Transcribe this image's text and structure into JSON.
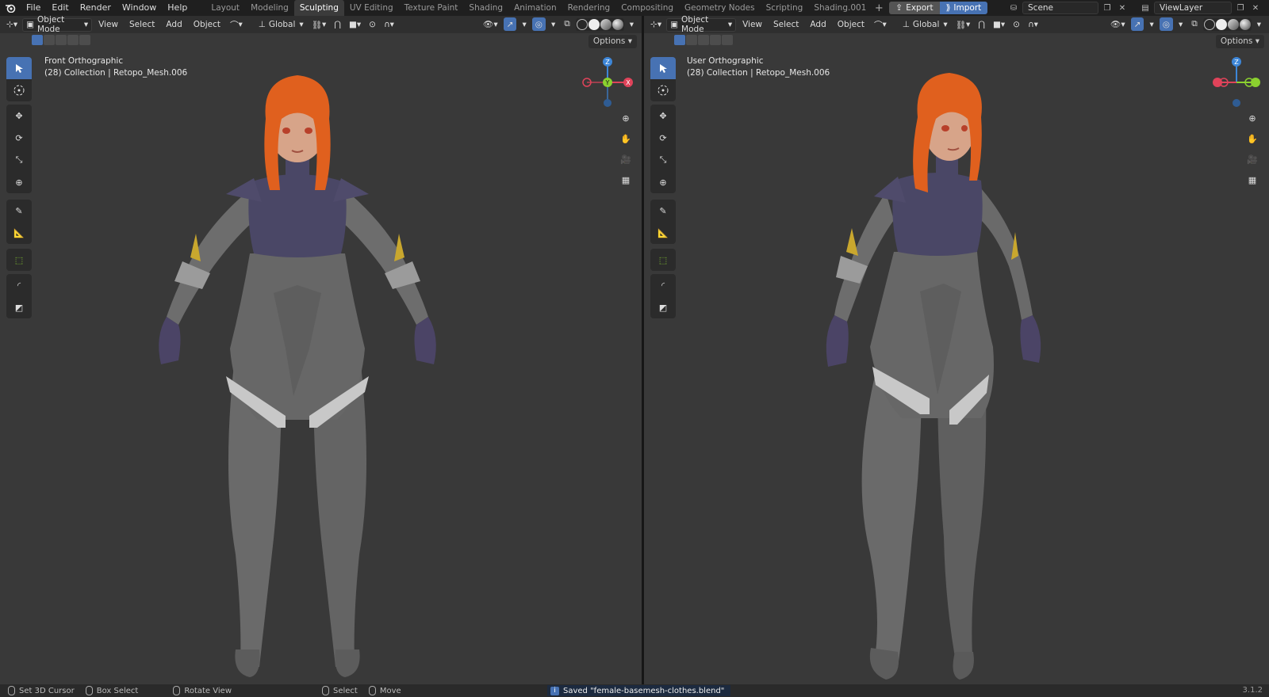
{
  "menu": [
    "File",
    "Edit",
    "Render",
    "Window",
    "Help"
  ],
  "workspaces": [
    "Layout",
    "Modeling",
    "Sculpting",
    "UV Editing",
    "Texture Paint",
    "Shading",
    "Animation",
    "Rendering",
    "Compositing",
    "Geometry Nodes",
    "Scripting",
    "Shading.001"
  ],
  "active_workspace": "Sculpting",
  "export_label": "Export",
  "import_label": "Import",
  "scene": "Scene",
  "view_layer": "ViewLayer",
  "header": {
    "mode": "Object Mode",
    "view": "View",
    "select": "Select",
    "add": "Add",
    "object": "Object",
    "orientation": "Global",
    "options": "Options"
  },
  "left_viewport": {
    "view_name": "Front Orthographic",
    "collection_info": "(28) Collection | Retopo_Mesh.006"
  },
  "right_viewport": {
    "view_name": "User Orthographic",
    "collection_info": "(28) Collection | Retopo_Mesh.006"
  },
  "gizmo_axes": {
    "z": "Z",
    "y": "Y",
    "x": "X"
  },
  "status": {
    "set_cursor": "Set 3D Cursor",
    "box_select": "Box Select",
    "rotate_view": "Rotate View",
    "select": "Select",
    "move": "Move",
    "message": "Saved \"female-basemesh-clothes.blend\"",
    "version": "3.1.2"
  },
  "colors": {
    "accent": "#4772b3",
    "viewport_bg": "#393939",
    "axis_x": "#e0435a",
    "axis_y": "#8bd12f",
    "axis_z": "#3d86d8",
    "hair": "#e0601e",
    "suit_top": "#4a4766",
    "suit_gray": "#666666"
  }
}
